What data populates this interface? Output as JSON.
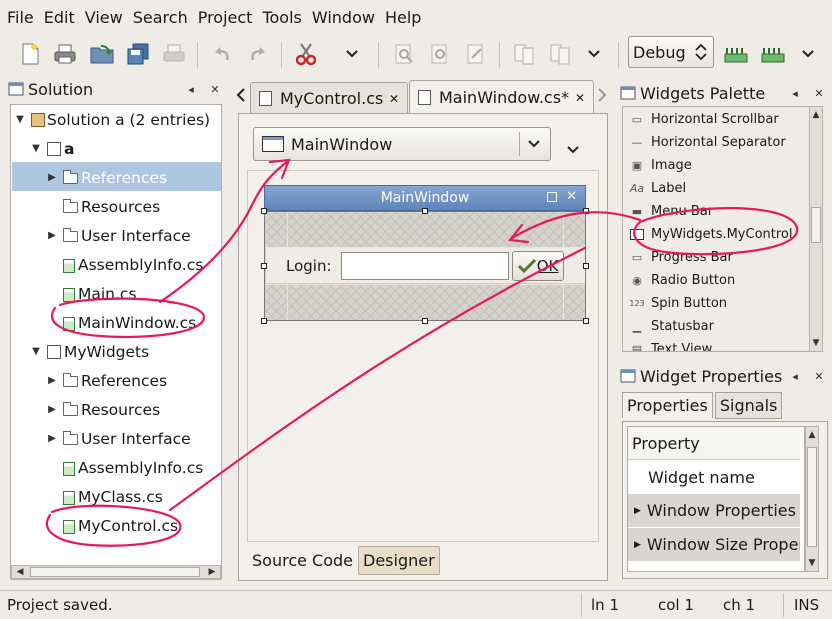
{
  "menu": [
    "File",
    "Edit",
    "View",
    "Search",
    "Project",
    "Tools",
    "Window",
    "Help"
  ],
  "toolbar": {
    "config": "Debug"
  },
  "solution": {
    "title": "Solution",
    "items": [
      {
        "label": "Solution a (2 entries)",
        "kind": "solution"
      },
      {
        "label": "a",
        "kind": "project"
      },
      {
        "label": "References",
        "kind": "folder",
        "selected": true
      },
      {
        "label": "Resources",
        "kind": "folder"
      },
      {
        "label": "User Interface",
        "kind": "folder"
      },
      {
        "label": "AssemblyInfo.cs",
        "kind": "cs"
      },
      {
        "label": "Main.cs",
        "kind": "cs"
      },
      {
        "label": "MainWindow.cs",
        "kind": "cs"
      },
      {
        "label": "MyWidgets",
        "kind": "project"
      },
      {
        "label": "References",
        "kind": "folder"
      },
      {
        "label": "Resources",
        "kind": "folder"
      },
      {
        "label": "User Interface",
        "kind": "folder"
      },
      {
        "label": "AssemblyInfo.cs",
        "kind": "cs"
      },
      {
        "label": "MyClass.cs",
        "kind": "cs"
      },
      {
        "label": "MyControl.cs",
        "kind": "cs"
      }
    ]
  },
  "tabs": [
    {
      "label": "MyControl.cs"
    },
    {
      "label": "MainWindow.cs*"
    }
  ],
  "designer": {
    "widget_combo": "MainWindow",
    "window_title": "MainWindow",
    "login_label": "Login:",
    "ok_label": "OK",
    "bottom_tabs": [
      "Source Code",
      "Designer"
    ]
  },
  "palette": {
    "title": "Widgets Palette",
    "items": [
      "Horizontal Scrollbar",
      "Horizontal Separator",
      "Image",
      "Label",
      "Menu Bar",
      "MyWidgets.MyControl",
      "Progress Bar",
      "Radio Button",
      "Spin Button",
      "Statusbar",
      "Text View"
    ]
  },
  "properties": {
    "title": "Widget Properties",
    "tabs": [
      "Properties",
      "Signals"
    ],
    "header": "Property",
    "rows": [
      "Widget name",
      "Window Properties",
      "Window Size Properties"
    ]
  },
  "status": {
    "message": "Project saved.",
    "line": "ln 1",
    "col": "col 1",
    "ch": "ch 1",
    "mode": "INS"
  },
  "colors": {
    "selection": "#aec6df",
    "annotation": "#e8185a",
    "titlebar": "#5f84b8"
  }
}
